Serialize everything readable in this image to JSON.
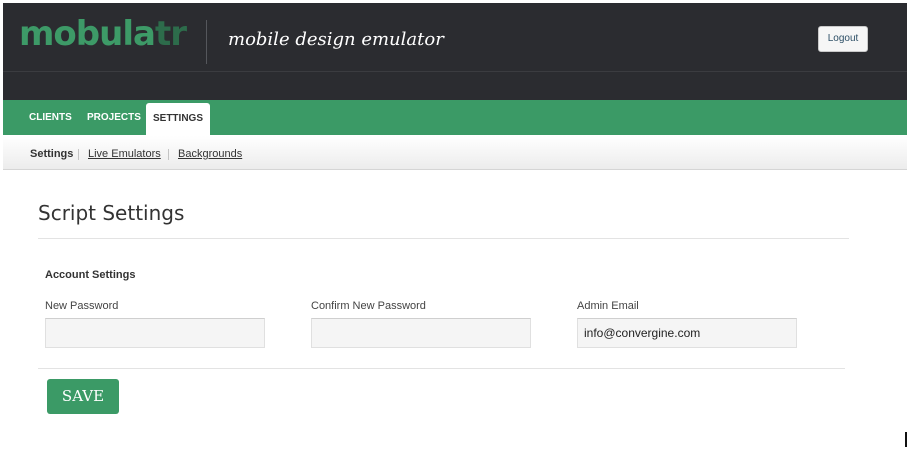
{
  "header": {
    "logo_main": "mobula",
    "logo_fade": "tr",
    "tagline": "mobile design emulator",
    "logout_label": "Logout"
  },
  "nav": {
    "tabs": [
      {
        "label": "CLIENTS",
        "active": false
      },
      {
        "label": "PROJECTS",
        "active": false
      },
      {
        "label": "SETTINGS",
        "active": true
      }
    ]
  },
  "subnav": {
    "items": [
      {
        "label": "Settings",
        "current": true
      },
      {
        "label": "Live Emulators",
        "current": false
      },
      {
        "label": "Backgrounds",
        "current": false
      }
    ]
  },
  "main": {
    "title": "Script Settings",
    "section_label": "Account Settings",
    "fields": [
      {
        "label": "New Password",
        "value": "",
        "placeholder": ""
      },
      {
        "label": "Confirm New Password",
        "value": "",
        "placeholder": ""
      },
      {
        "label": "Admin Email",
        "value": "info@convergine.com",
        "placeholder": ""
      }
    ],
    "save_label": "SAVE"
  },
  "colors": {
    "brand_green": "#3b9a66",
    "header_dark": "#2b2c30"
  }
}
